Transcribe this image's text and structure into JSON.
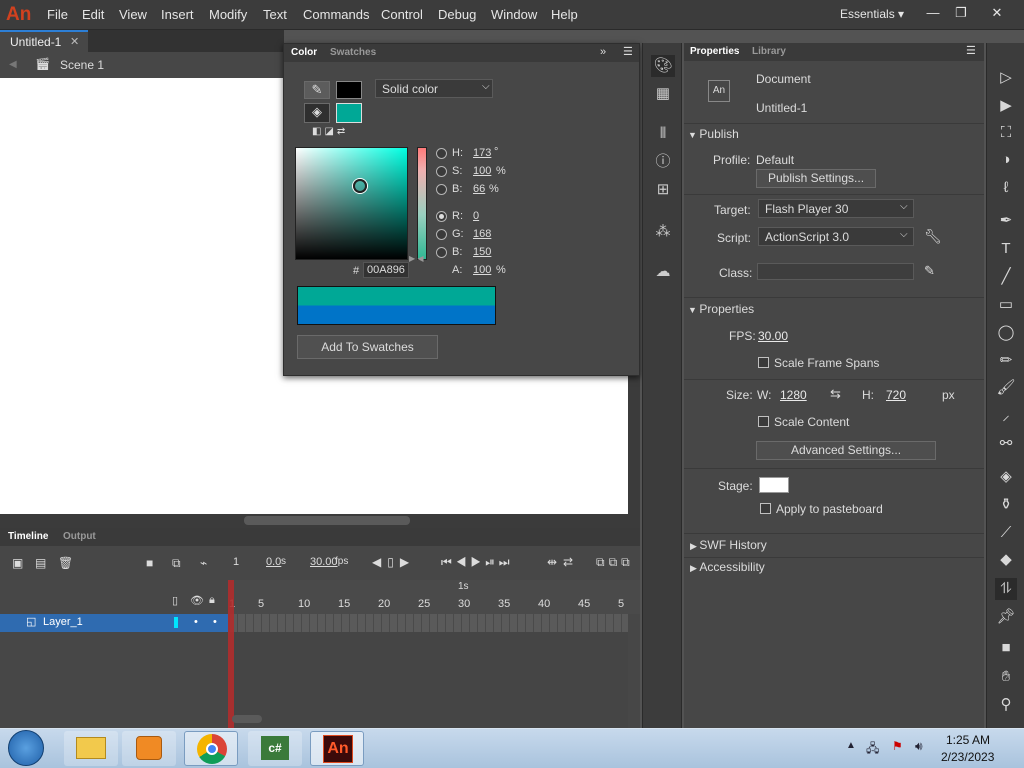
{
  "app": {
    "logo": "An"
  },
  "menu": {
    "items": [
      "File",
      "Edit",
      "View",
      "Insert",
      "Modify",
      "Text",
      "Commands",
      "Control",
      "Debug",
      "Window",
      "Help"
    ],
    "workspace": "Essentials"
  },
  "window_controls": {
    "minimize": "—",
    "restore": "❐",
    "close": "✕"
  },
  "document": {
    "tab": "Untitled-1",
    "scene": "Scene 1"
  },
  "color_panel": {
    "tabs": [
      "Color",
      "Swatches"
    ],
    "fill_type": "Solid color",
    "stroke_color": "#000000",
    "fill_color": "#00A896",
    "hsb": {
      "H_label": "H:",
      "H": "173",
      "H_unit": "°",
      "S_label": "S:",
      "S": "100",
      "S_unit": "%",
      "B_label": "B:",
      "B": "66",
      "B_unit": "%"
    },
    "rgb": {
      "R_label": "R:",
      "R": "0",
      "G_label": "G:",
      "G": "168",
      "B_label": "B:",
      "B": "150",
      "A_label": "A:",
      "A": "100",
      "A_unit": "%"
    },
    "hex_hash": "#",
    "hex": "00A896",
    "add_button": "Add To Swatches",
    "selected_channel": "R"
  },
  "properties": {
    "tabs": [
      "Properties",
      "Library"
    ],
    "doc_icon": "An",
    "doc_type": "Document",
    "doc_name": "Untitled-1",
    "publish": {
      "title": "Publish",
      "profile_label": "Profile:",
      "profile": "Default",
      "settings_button": "Publish Settings...",
      "target_label": "Target:",
      "target": "Flash Player 30",
      "script_label": "Script:",
      "script": "ActionScript 3.0",
      "class_label": "Class:"
    },
    "props": {
      "title": "Properties",
      "fps_label": "FPS:",
      "fps": "30.00",
      "scale_spans": "Scale Frame Spans",
      "size_label": "Size:",
      "w_label": "W:",
      "w": "1280",
      "h_label": "H:",
      "h": "720",
      "unit": "px",
      "scale_content": "Scale Content",
      "advanced_button": "Advanced Settings...",
      "stage_label": "Stage:",
      "stage_color": "#FFFFFF",
      "pasteboard": "Apply to pasteboard"
    },
    "swf_history": "SWF History",
    "accessibility": "Accessibility"
  },
  "timeline": {
    "tabs": [
      "Timeline",
      "Output"
    ],
    "frame": "1",
    "time": "0.0",
    "time_unit": "s",
    "fps": "30.00",
    "fps_unit": "fps",
    "ruler_second": "1s",
    "ruler": [
      "1",
      "5",
      "10",
      "15",
      "20",
      "25",
      "30",
      "35",
      "40",
      "45",
      "5"
    ],
    "layer": "Layer_1"
  },
  "taskbar": {
    "time": "1:25 AM",
    "date": "2/23/2023"
  }
}
